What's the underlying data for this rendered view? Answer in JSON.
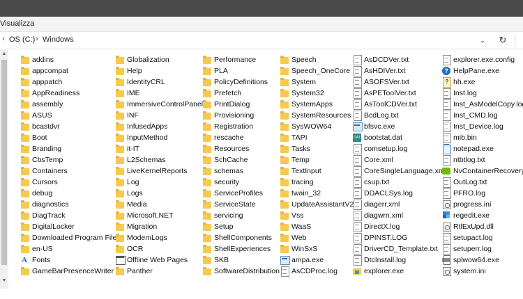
{
  "menu": {
    "view_label": "Visualizza"
  },
  "address": {
    "chevron": "›",
    "drive": "OS (C:)",
    "separator": "›",
    "folder": "Windows"
  },
  "icons": {
    "folder": "folder-icon",
    "text_file": "text-file-icon",
    "config_file": "config-file-icon",
    "help_file": "help-icon",
    "font": "font-icon",
    "web_page": "web-page-icon",
    "dat_file": "dat-file-icon",
    "app": "application-icon"
  },
  "colors": {
    "title_bar": "#4a4a4a",
    "folder": "#f6c94f",
    "menu_bg": "#f3f3f3"
  },
  "columns": [
    {
      "items": [
        {
          "name": "addins",
          "icon": "folder"
        },
        {
          "name": "appcompat",
          "icon": "folder"
        },
        {
          "name": "apppatch",
          "icon": "folder"
        },
        {
          "name": "AppReadiness",
          "icon": "folder"
        },
        {
          "name": "assembly",
          "icon": "folder"
        },
        {
          "name": "ASUS",
          "icon": "folder"
        },
        {
          "name": "bcastdvr",
          "icon": "folder"
        },
        {
          "name": "Boot",
          "icon": "folder"
        },
        {
          "name": "Branding",
          "icon": "folder"
        },
        {
          "name": "CbsTemp",
          "icon": "folder"
        },
        {
          "name": "Containers",
          "icon": "folder"
        },
        {
          "name": "Cursors",
          "icon": "folder"
        },
        {
          "name": "debug",
          "icon": "folder"
        },
        {
          "name": "diagnostics",
          "icon": "folder"
        },
        {
          "name": "DiagTrack",
          "icon": "folder"
        },
        {
          "name": "DigitalLocker",
          "icon": "folder"
        },
        {
          "name": "Downloaded Program Files",
          "icon": "folder"
        },
        {
          "name": "en-US",
          "icon": "folder"
        },
        {
          "name": "Fonts",
          "icon": "font"
        },
        {
          "name": "GameBarPresenceWriter",
          "icon": "folder"
        }
      ]
    },
    {
      "items": [
        {
          "name": "Globalization",
          "icon": "folder"
        },
        {
          "name": "Help",
          "icon": "folder"
        },
        {
          "name": "IdentityCRL",
          "icon": "folder"
        },
        {
          "name": "IME",
          "icon": "folder"
        },
        {
          "name": "ImmersiveControlPanel",
          "icon": "folder"
        },
        {
          "name": "INF",
          "icon": "folder"
        },
        {
          "name": "InfusedApps",
          "icon": "folder"
        },
        {
          "name": "InputMethod",
          "icon": "folder"
        },
        {
          "name": "it-IT",
          "icon": "folder"
        },
        {
          "name": "L2Schemas",
          "icon": "folder"
        },
        {
          "name": "LiveKernelReports",
          "icon": "folder"
        },
        {
          "name": "Log",
          "icon": "folder"
        },
        {
          "name": "Logs",
          "icon": "folder"
        },
        {
          "name": "Media",
          "icon": "folder"
        },
        {
          "name": "Microsoft.NET",
          "icon": "folder"
        },
        {
          "name": "Migration",
          "icon": "folder"
        },
        {
          "name": "ModemLogs",
          "icon": "folder"
        },
        {
          "name": "OCR",
          "icon": "folder"
        },
        {
          "name": "Offline Web Pages",
          "icon": "web"
        },
        {
          "name": "Panther",
          "icon": "folder"
        }
      ]
    },
    {
      "items": [
        {
          "name": "Performance",
          "icon": "folder"
        },
        {
          "name": "PLA",
          "icon": "folder"
        },
        {
          "name": "PolicyDefinitions",
          "icon": "folder"
        },
        {
          "name": "Prefetch",
          "icon": "folder"
        },
        {
          "name": "PrintDialog",
          "icon": "folder"
        },
        {
          "name": "Provisioning",
          "icon": "folder"
        },
        {
          "name": "Registration",
          "icon": "folder"
        },
        {
          "name": "rescache",
          "icon": "folder"
        },
        {
          "name": "Resources",
          "icon": "folder"
        },
        {
          "name": "SchCache",
          "icon": "folder"
        },
        {
          "name": "schemas",
          "icon": "folder"
        },
        {
          "name": "security",
          "icon": "folder"
        },
        {
          "name": "ServiceProfiles",
          "icon": "folder"
        },
        {
          "name": "ServiceState",
          "icon": "folder"
        },
        {
          "name": "servicing",
          "icon": "folder"
        },
        {
          "name": "Setup",
          "icon": "folder"
        },
        {
          "name": "ShellComponents",
          "icon": "folder"
        },
        {
          "name": "ShellExperiences",
          "icon": "folder"
        },
        {
          "name": "SKB",
          "icon": "folder"
        },
        {
          "name": "SoftwareDistribution",
          "icon": "folder"
        }
      ]
    },
    {
      "items": [
        {
          "name": "Speech",
          "icon": "folder"
        },
        {
          "name": "Speech_OneCore",
          "icon": "folder"
        },
        {
          "name": "System",
          "icon": "folder"
        },
        {
          "name": "System32",
          "icon": "folder"
        },
        {
          "name": "SystemApps",
          "icon": "folder"
        },
        {
          "name": "SystemResources",
          "icon": "folder"
        },
        {
          "name": "SysWOW64",
          "icon": "folder"
        },
        {
          "name": "TAPI",
          "icon": "folder"
        },
        {
          "name": "Tasks",
          "icon": "folder"
        },
        {
          "name": "Temp",
          "icon": "folder"
        },
        {
          "name": "TextInput",
          "icon": "folder"
        },
        {
          "name": "tracing",
          "icon": "folder"
        },
        {
          "name": "twain_32",
          "icon": "folder"
        },
        {
          "name": "UpdateAssistantV2",
          "icon": "folder"
        },
        {
          "name": "Vss",
          "icon": "folder"
        },
        {
          "name": "WaaS",
          "icon": "folder"
        },
        {
          "name": "Web",
          "icon": "folder"
        },
        {
          "name": "WinSxS",
          "icon": "folder"
        },
        {
          "name": "ampa.exe",
          "icon": "exe"
        },
        {
          "name": "AsCDProc.log",
          "icon": "doc"
        }
      ]
    },
    {
      "items": [
        {
          "name": "AsDCDVer.txt",
          "icon": "doc"
        },
        {
          "name": "AsHDIVer.txt",
          "icon": "doc"
        },
        {
          "name": "ASOFSVer.txt",
          "icon": "doc"
        },
        {
          "name": "AsPEToolVer.txt",
          "icon": "doc"
        },
        {
          "name": "AsToolCDVer.txt",
          "icon": "doc"
        },
        {
          "name": "BcdLog.txt",
          "icon": "doc"
        },
        {
          "name": "bfsvc.exe",
          "icon": "exe"
        },
        {
          "name": "bootstat.dat",
          "icon": "dat"
        },
        {
          "name": "comsetup.log",
          "icon": "doc"
        },
        {
          "name": "Core.xml",
          "icon": "doc"
        },
        {
          "name": "CoreSingleLanguage.xml",
          "icon": "doc"
        },
        {
          "name": "csup.txt",
          "icon": "doc"
        },
        {
          "name": "DDACLSys.log",
          "icon": "doc"
        },
        {
          "name": "diagerr.xml",
          "icon": "doc"
        },
        {
          "name": "diagwrn.xml",
          "icon": "doc"
        },
        {
          "name": "DirectX.log",
          "icon": "doc"
        },
        {
          "name": "DPINST.LOG",
          "icon": "doc"
        },
        {
          "name": "DriverCD_Template.txt",
          "icon": "doc"
        },
        {
          "name": "DtcInstall.log",
          "icon": "doc"
        },
        {
          "name": "explorer.exe",
          "icon": "explorer"
        }
      ]
    },
    {
      "items": [
        {
          "name": "explorer.exe.config",
          "icon": "doc"
        },
        {
          "name": "HelpPane.exe",
          "icon": "help"
        },
        {
          "name": "hh.exe",
          "icon": "hh"
        },
        {
          "name": "Inst.log",
          "icon": "doc"
        },
        {
          "name": "Inst_AsModelCopy.log",
          "icon": "doc"
        },
        {
          "name": "Inst_CMD.log",
          "icon": "doc"
        },
        {
          "name": "Inst_Device.log",
          "icon": "doc"
        },
        {
          "name": "mib.bin",
          "icon": "doc"
        },
        {
          "name": "notepad.exe",
          "icon": "notepad"
        },
        {
          "name": "ntbtlog.txt",
          "icon": "doc"
        },
        {
          "name": "NvContainerRecovery.bat",
          "icon": "nvidia"
        },
        {
          "name": "OutLog.txt",
          "icon": "doc"
        },
        {
          "name": "PFRO.log",
          "icon": "doc"
        },
        {
          "name": "progress.ini",
          "icon": "gear"
        },
        {
          "name": "regedit.exe",
          "icon": "regedit"
        },
        {
          "name": "RtlExUpd.dll",
          "icon": "gear"
        },
        {
          "name": "setupact.log",
          "icon": "doc"
        },
        {
          "name": "setuperr.log",
          "icon": "doc"
        },
        {
          "name": "splwow64.exe",
          "icon": "printer"
        },
        {
          "name": "system.ini",
          "icon": "gear"
        }
      ]
    }
  ]
}
